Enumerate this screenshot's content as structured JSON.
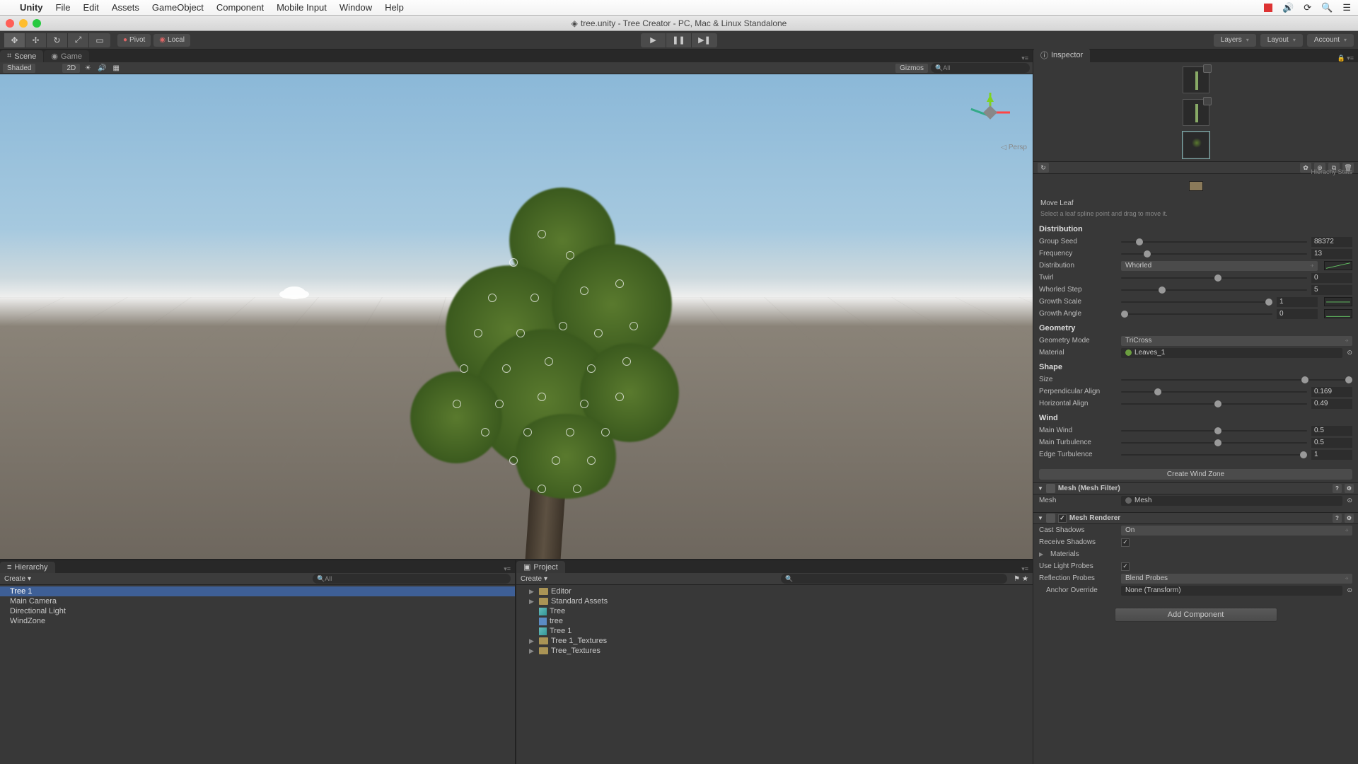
{
  "mac_menu": {
    "app": "Unity",
    "items": [
      "File",
      "Edit",
      "Assets",
      "GameObject",
      "Component",
      "Mobile Input",
      "Window",
      "Help"
    ]
  },
  "window_title": "tree.unity - Tree Creator - PC, Mac & Linux Standalone",
  "toolbar": {
    "pivot": "Pivot",
    "local": "Local",
    "layers": "Layers",
    "layout": "Layout",
    "account": "Account"
  },
  "tabs": {
    "scene": "Scene",
    "game": "Game"
  },
  "scene_ctrl": {
    "shaded": "Shaded",
    "mode2d": "2D",
    "gizmos": "Gizmos",
    "search_ph": "All"
  },
  "gizmo_label": "Persp",
  "hierarchy": {
    "tab": "Hierarchy",
    "create": "Create",
    "search_ph": "All",
    "items": [
      "Tree 1",
      "Main Camera",
      "Directional Light",
      "WindZone"
    ]
  },
  "project": {
    "tab": "Project",
    "create": "Create",
    "items": [
      {
        "name": "Editor",
        "type": "folder"
      },
      {
        "name": "Standard Assets",
        "type": "folder"
      },
      {
        "name": "Tree",
        "type": "asset"
      },
      {
        "name": "tree",
        "type": "scene"
      },
      {
        "name": "Tree 1",
        "type": "asset"
      },
      {
        "name": "Tree 1_Textures",
        "type": "folder"
      },
      {
        "name": "Tree_Textures",
        "type": "folder"
      }
    ]
  },
  "inspector": {
    "tab": "Inspector",
    "hier_stats": "Hierachy Stats",
    "move_leaf_title": "Move Leaf",
    "move_leaf_hint": "Select a leaf spline point and drag to move it.",
    "sections": {
      "distribution": "Distribution",
      "geometry": "Geometry",
      "shape": "Shape",
      "wind": "Wind"
    },
    "distribution": {
      "group_seed": {
        "label": "Group Seed",
        "value": "88372",
        "pos": 8
      },
      "frequency": {
        "label": "Frequency",
        "value": "13",
        "pos": 12
      },
      "distribution": {
        "label": "Distribution",
        "value": "Whorled"
      },
      "twirl": {
        "label": "Twirl",
        "value": "0",
        "pos": 50
      },
      "whorled_step": {
        "label": "Whorled Step",
        "value": "5",
        "pos": 20
      },
      "growth_scale": {
        "label": "Growth Scale",
        "value": "1",
        "pos": 100
      },
      "growth_angle": {
        "label": "Growth Angle",
        "value": "0",
        "pos": 0
      }
    },
    "geometry": {
      "mode": {
        "label": "Geometry Mode",
        "value": "TriCross"
      },
      "material": {
        "label": "Material",
        "value": "Leaves_1"
      }
    },
    "shape": {
      "size": {
        "label": "Size",
        "pos": 80
      },
      "perp": {
        "label": "Perpendicular Align",
        "value": "0.169",
        "pos": 18
      },
      "horiz": {
        "label": "Horizontal Align",
        "value": "0.49",
        "pos": 50
      }
    },
    "wind": {
      "main": {
        "label": "Main Wind",
        "value": "0.5",
        "pos": 50
      },
      "turb": {
        "label": "Main Turbulence",
        "value": "0.5",
        "pos": 50
      },
      "edge": {
        "label": "Edge Turbulence",
        "value": "1",
        "pos": 100
      }
    },
    "create_wind": "Create Wind Zone",
    "mesh_filter": {
      "title": "Mesh (Mesh Filter)",
      "mesh_label": "Mesh",
      "mesh_value": "Mesh"
    },
    "mesh_renderer": {
      "title": "Mesh Renderer",
      "cast_shadows": {
        "label": "Cast Shadows",
        "value": "On"
      },
      "receive_shadows": {
        "label": "Receive Shadows",
        "checked": true
      },
      "materials": {
        "label": "Materials"
      },
      "use_light": {
        "label": "Use Light Probes",
        "checked": true
      },
      "reflection": {
        "label": "Reflection Probes",
        "value": "Blend Probes"
      },
      "anchor": {
        "label": "Anchor Override",
        "value": "None (Transform)"
      }
    },
    "add_component": "Add Component"
  }
}
